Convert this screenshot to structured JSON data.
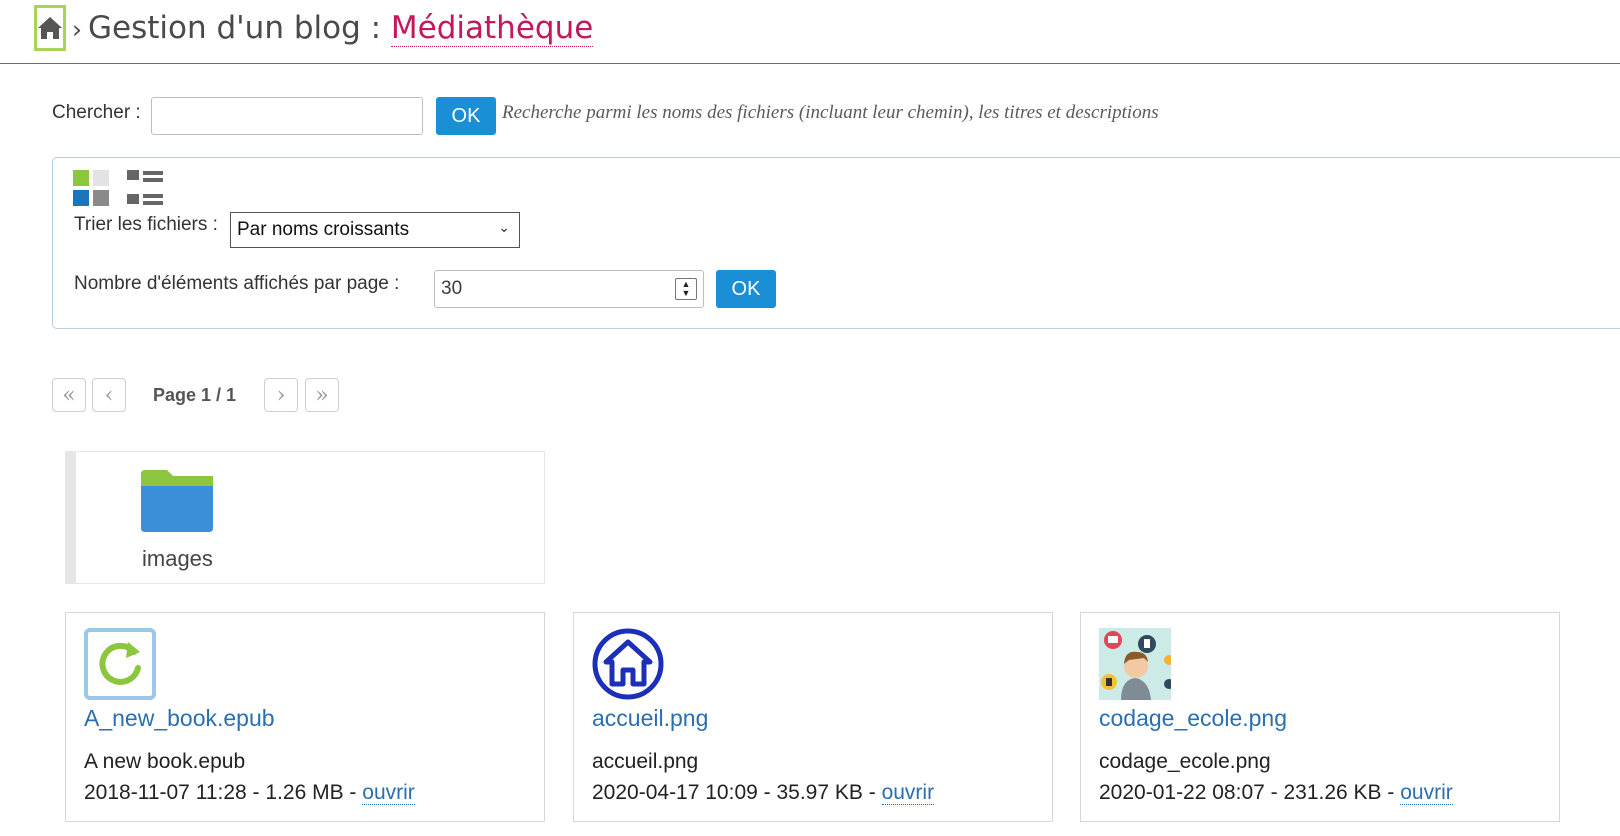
{
  "breadcrumb": {
    "home_icon": "home-icon",
    "separator": "›",
    "parent": "Gestion d'un blog :",
    "current": "Médiathèque"
  },
  "search": {
    "label": "Chercher :",
    "value": "",
    "placeholder": "",
    "ok_label": "OK",
    "hint": "Recherche parmi les noms des fichiers (incluant leur chemin), les titres et descriptions"
  },
  "options": {
    "view_modes": [
      "grid-view-icon",
      "list-view-icon"
    ],
    "sort_label": "Trier les fichiers :",
    "sort_selected": "Par noms croissants",
    "count_label": "Nombre d'éléments affichés par page :",
    "count_value": "30",
    "ok_label": "OK"
  },
  "pager": {
    "first": "«",
    "prev": "‹",
    "label": "Page 1 / 1",
    "next": "›",
    "last": "»"
  },
  "folders": [
    {
      "name": "images",
      "icon": "folder-icon"
    }
  ],
  "files": [
    {
      "name": "A_new_book.epub",
      "title": "A new book.epub",
      "date": "2018-11-07 11:28",
      "size": "1.26 MB",
      "open_label": "ouvrir",
      "icon": "refresh-icon"
    },
    {
      "name": "accueil.png",
      "title": "accueil.png",
      "date": "2020-04-17 10:09",
      "size": "35.97 KB",
      "open_label": "ouvrir",
      "icon": "home-circle-icon"
    },
    {
      "name": "codage_ecole.png",
      "title": "codage_ecole.png",
      "date": "2020-01-22 08:07",
      "size": "231.26 KB",
      "open_label": "ouvrir",
      "icon": "coding-illustration-icon"
    }
  ],
  "colors": {
    "accent_blue": "#1a8fd6",
    "link_blue": "#2a6fb0",
    "breadcrumb_current": "#c4175d",
    "folder_green": "#8cc63f",
    "folder_blue": "#3a8fd8",
    "home_highlight": "#a8d45a"
  }
}
